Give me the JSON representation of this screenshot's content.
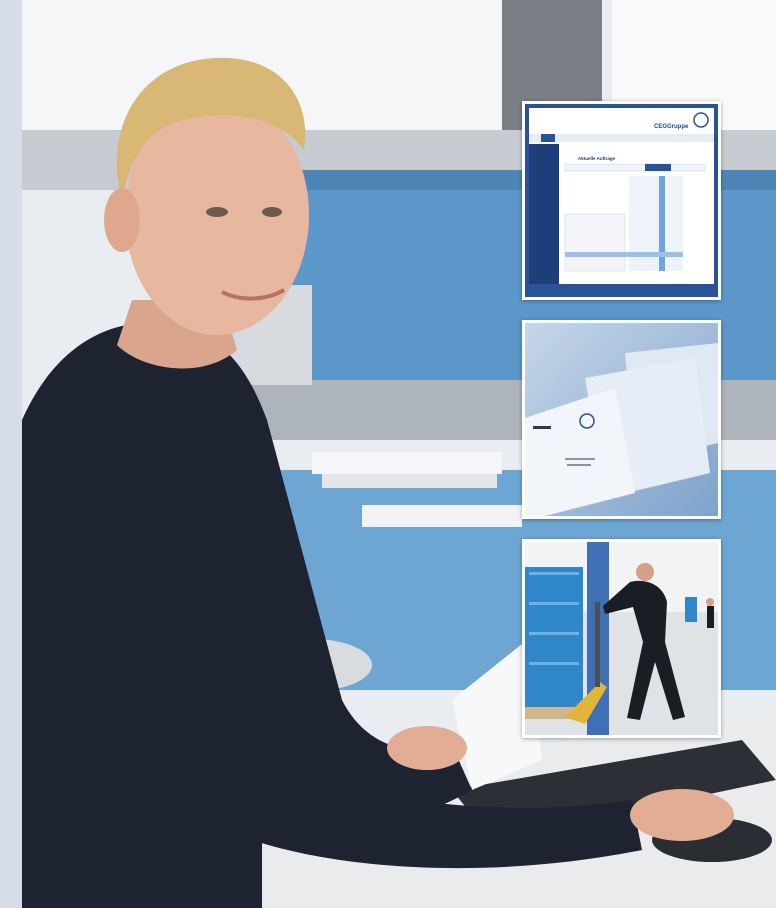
{
  "photo": {
    "subject": "office-worker",
    "colors": {
      "sky": "#f2f5f8",
      "partition_blue": "#5b97c8",
      "sweater": "#1d2330",
      "skin": "#e7b7a0",
      "hair": "#d9b774",
      "desk": "#eceef0",
      "strip": "#d6dde9"
    }
  },
  "insets": {
    "screen": {
      "brand": "CEGGruppe",
      "heading": "Aktuelle Auftrage",
      "colors": {
        "frame": "#2a5298",
        "panel": "#1c3f7a",
        "highlight": "#6fa4dd"
      }
    },
    "letters": {
      "colors": {
        "envelope": "#eaf0f7",
        "shadow": "#9fb6d2"
      }
    },
    "warehouse": {
      "colors": {
        "crates": "#2f86c9",
        "pallet_jack": "#e2b43a",
        "worker": "#1a1d24"
      }
    }
  }
}
